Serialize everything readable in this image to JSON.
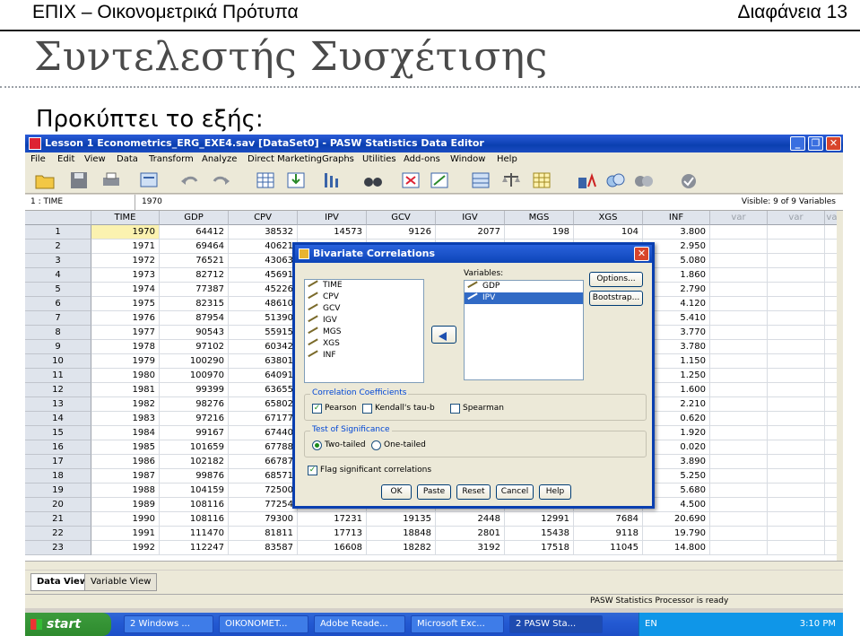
{
  "slide": {
    "header_left": "ΕΠΙΧ – Οικονομετρικά Πρότυπα",
    "header_right": "Διαφάνεια 13",
    "title": "Συντελεστής Συσχέτισης",
    "intro": "Προκύπτει το εξής:"
  },
  "window": {
    "title": "Lesson 1 Econometrics_ERG_EXE4.sav [DataSet0] - PASW Statistics Data Editor",
    "controls": [
      "_",
      "❐",
      "✕"
    ]
  },
  "menu": [
    "File",
    "Edit",
    "View",
    "Data",
    "Transform",
    "Analyze",
    "Direct Marketing",
    "Graphs",
    "Utilities",
    "Add-ons",
    "Window",
    "Help"
  ],
  "toolbar_icons": [
    "open-icon",
    "save-icon",
    "print-icon",
    "dialog-recall-icon",
    "undo-icon",
    "redo-icon",
    "goto-case-icon",
    "goto-variable-icon",
    "variables-icon",
    "find-icon",
    "insert-cases-icon",
    "insert-variable-icon",
    "split-file-icon",
    "weight-cases-icon",
    "select-cases-icon",
    "value-labels-icon",
    "use-sets-icon",
    "show-all-icon",
    "spelling-icon"
  ],
  "cellref": {
    "name": "1 : TIME",
    "value": "1970",
    "visible": "Visible: 9 of 9 Variables"
  },
  "grid": {
    "columns": [
      "TIME",
      "GDP",
      "CPV",
      "IPV",
      "GCV",
      "IGV",
      "MGS",
      "XGS",
      "INF",
      "var",
      "var",
      "var"
    ],
    "rows": [
      {
        "n": "1",
        "cells": [
          "1970",
          "64412",
          "38532",
          "14573",
          "9126",
          "2077",
          "198",
          "104",
          "3.800"
        ]
      },
      {
        "n": "2",
        "cells": [
          "1971",
          "69464",
          "40621",
          "",
          "",
          "",
          "",
          "",
          "2.950"
        ]
      },
      {
        "n": "3",
        "cells": [
          "1972",
          "76521",
          "43063",
          "",
          "",
          "",
          "",
          "",
          "5.080"
        ]
      },
      {
        "n": "4",
        "cells": [
          "1973",
          "82712",
          "45691",
          "",
          "",
          "",
          "",
          "",
          "1.860"
        ]
      },
      {
        "n": "5",
        "cells": [
          "1974",
          "77387",
          "45226",
          "",
          "",
          "",
          "",
          "",
          "2.790"
        ]
      },
      {
        "n": "6",
        "cells": [
          "1975",
          "82315",
          "48610",
          "",
          "",
          "",
          "",
          "",
          "4.120"
        ]
      },
      {
        "n": "7",
        "cells": [
          "1976",
          "87954",
          "51390",
          "",
          "",
          "",
          "",
          "",
          "5.410"
        ]
      },
      {
        "n": "8",
        "cells": [
          "1977",
          "90543",
          "55915",
          "",
          "",
          "",
          "",
          "",
          "3.770"
        ]
      },
      {
        "n": "9",
        "cells": [
          "1978",
          "97102",
          "60342",
          "",
          "",
          "",
          "",
          "",
          "3.780"
        ]
      },
      {
        "n": "10",
        "cells": [
          "1979",
          "100290",
          "63801",
          "",
          "",
          "",
          "",
          "",
          "1.150"
        ]
      },
      {
        "n": "11",
        "cells": [
          "1980",
          "100970",
          "64091",
          "",
          "",
          "",
          "",
          "",
          "1.250"
        ]
      },
      {
        "n": "12",
        "cells": [
          "1981",
          "99399",
          "63655",
          "",
          "",
          "",
          "",
          "",
          "1.600"
        ]
      },
      {
        "n": "13",
        "cells": [
          "1982",
          "98276",
          "65802",
          "",
          "",
          "",
          "",
          "",
          "2.210"
        ]
      },
      {
        "n": "14",
        "cells": [
          "1983",
          "97216",
          "67177",
          "",
          "",
          "",
          "",
          "",
          "0.620"
        ]
      },
      {
        "n": "15",
        "cells": [
          "1984",
          "99167",
          "67440",
          "",
          "",
          "",
          "",
          "",
          "1.920"
        ]
      },
      {
        "n": "16",
        "cells": [
          "1985",
          "101659",
          "67788",
          "",
          "",
          "",
          "",
          "",
          "0.020"
        ]
      },
      {
        "n": "17",
        "cells": [
          "1986",
          "102182",
          "66787",
          "",
          "",
          "",
          "",
          "",
          "3.890"
        ]
      },
      {
        "n": "18",
        "cells": [
          "1987",
          "99876",
          "68571",
          "",
          "",
          "",
          "",
          "",
          "5.250"
        ]
      },
      {
        "n": "19",
        "cells": [
          "1988",
          "104159",
          "72500",
          "",
          "",
          "",
          "",
          "",
          "5.680"
        ]
      },
      {
        "n": "20",
        "cells": [
          "1989",
          "108116",
          "77254",
          "",
          "",
          "",
          "",
          "",
          "4.500"
        ]
      },
      {
        "n": "21",
        "cells": [
          "1990",
          "108116",
          "79300",
          "17231",
          "19135",
          "2448",
          "12991",
          "7684",
          "20.690"
        ]
      },
      {
        "n": "22",
        "cells": [
          "1991",
          "111470",
          "81811",
          "17713",
          "18848",
          "2801",
          "15438",
          "9118",
          "19.790"
        ]
      },
      {
        "n": "23",
        "cells": [
          "1992",
          "112247",
          "83587",
          "16608",
          "18282",
          "3192",
          "17518",
          "11045",
          "14.800"
        ]
      }
    ]
  },
  "tabs": [
    "Data View",
    "Variable View"
  ],
  "status": "PASW Statistics Processor is ready",
  "taskbar": {
    "start": "start",
    "tasks": [
      "2 Windows ...",
      "OIKONOMET...",
      "Adobe Reade...",
      "Microsoft Exc...",
      "2 PASW Sta..."
    ],
    "lang": "EN",
    "time": "3:10 PM"
  },
  "dialog": {
    "title": "Bivariate Correlations",
    "source_vars": [
      "TIME",
      "CPV",
      "GCV",
      "IGV",
      "MGS",
      "XGS",
      "INF"
    ],
    "variables_label": "Variables:",
    "target_vars": [
      "GDP",
      "IPV"
    ],
    "options_btn": "Options...",
    "bootstrap_btn": "Bootstrap...",
    "coef_group": "Correlation Coefficients",
    "pearson": "Pearson",
    "kendall": "Kendall's tau-b",
    "spearman": "Spearman",
    "sig_group": "Test of Significance",
    "two_tailed": "Two-tailed",
    "one_tailed": "One-tailed",
    "flag": "Flag significant correlations",
    "buttons": [
      "OK",
      "Paste",
      "Reset",
      "Cancel",
      "Help"
    ]
  }
}
